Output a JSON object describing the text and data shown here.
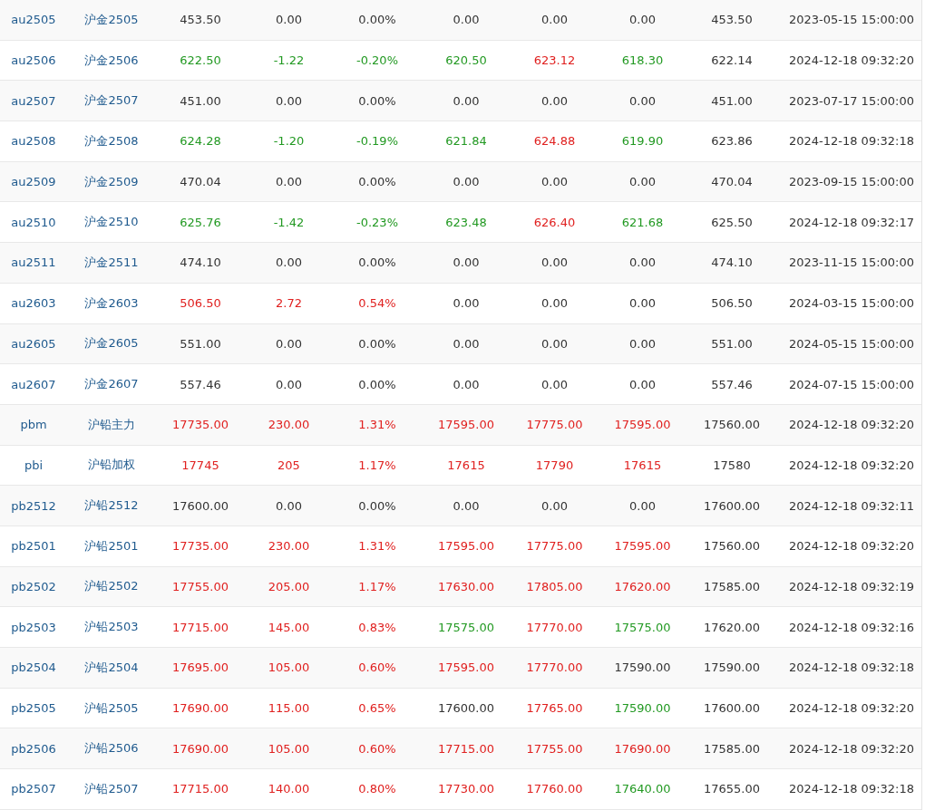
{
  "rows": [
    {
      "code": "au2505",
      "name": "沪金2505",
      "cells": [
        {
          "text": "453.50",
          "color": "#333333"
        },
        {
          "text": "0.00",
          "color": "#333333"
        },
        {
          "text": "0.00%",
          "color": "#333333"
        },
        {
          "text": "0.00",
          "color": "#333333"
        },
        {
          "text": "0.00",
          "color": "#333333"
        },
        {
          "text": "0.00",
          "color": "#333333"
        },
        {
          "text": "453.50",
          "color": "#333333"
        }
      ],
      "time": "2023-05-15 15:00:00"
    },
    {
      "code": "au2506",
      "name": "沪金2506",
      "cells": [
        {
          "text": "622.50",
          "color": "#229922"
        },
        {
          "text": "-1.22",
          "color": "#229922"
        },
        {
          "text": "-0.20%",
          "color": "#229922"
        },
        {
          "text": "620.50",
          "color": "#229922"
        },
        {
          "text": "623.12",
          "color": "#e0201f"
        },
        {
          "text": "618.30",
          "color": "#229922"
        },
        {
          "text": "622.14",
          "color": "#333333"
        }
      ],
      "time": "2024-12-18 09:32:20"
    },
    {
      "code": "au2507",
      "name": "沪金2507",
      "cells": [
        {
          "text": "451.00",
          "color": "#333333"
        },
        {
          "text": "0.00",
          "color": "#333333"
        },
        {
          "text": "0.00%",
          "color": "#333333"
        },
        {
          "text": "0.00",
          "color": "#333333"
        },
        {
          "text": "0.00",
          "color": "#333333"
        },
        {
          "text": "0.00",
          "color": "#333333"
        },
        {
          "text": "451.00",
          "color": "#333333"
        }
      ],
      "time": "2023-07-17 15:00:00"
    },
    {
      "code": "au2508",
      "name": "沪金2508",
      "cells": [
        {
          "text": "624.28",
          "color": "#229922"
        },
        {
          "text": "-1.20",
          "color": "#229922"
        },
        {
          "text": "-0.19%",
          "color": "#229922"
        },
        {
          "text": "621.84",
          "color": "#229922"
        },
        {
          "text": "624.88",
          "color": "#e0201f"
        },
        {
          "text": "619.90",
          "color": "#229922"
        },
        {
          "text": "623.86",
          "color": "#333333"
        }
      ],
      "time": "2024-12-18 09:32:18"
    },
    {
      "code": "au2509",
      "name": "沪金2509",
      "cells": [
        {
          "text": "470.04",
          "color": "#333333"
        },
        {
          "text": "0.00",
          "color": "#333333"
        },
        {
          "text": "0.00%",
          "color": "#333333"
        },
        {
          "text": "0.00",
          "color": "#333333"
        },
        {
          "text": "0.00",
          "color": "#333333"
        },
        {
          "text": "0.00",
          "color": "#333333"
        },
        {
          "text": "470.04",
          "color": "#333333"
        }
      ],
      "time": "2023-09-15 15:00:00"
    },
    {
      "code": "au2510",
      "name": "沪金2510",
      "cells": [
        {
          "text": "625.76",
          "color": "#229922"
        },
        {
          "text": "-1.42",
          "color": "#229922"
        },
        {
          "text": "-0.23%",
          "color": "#229922"
        },
        {
          "text": "623.48",
          "color": "#229922"
        },
        {
          "text": "626.40",
          "color": "#e0201f"
        },
        {
          "text": "621.68",
          "color": "#229922"
        },
        {
          "text": "625.50",
          "color": "#333333"
        }
      ],
      "time": "2024-12-18 09:32:17"
    },
    {
      "code": "au2511",
      "name": "沪金2511",
      "cells": [
        {
          "text": "474.10",
          "color": "#333333"
        },
        {
          "text": "0.00",
          "color": "#333333"
        },
        {
          "text": "0.00%",
          "color": "#333333"
        },
        {
          "text": "0.00",
          "color": "#333333"
        },
        {
          "text": "0.00",
          "color": "#333333"
        },
        {
          "text": "0.00",
          "color": "#333333"
        },
        {
          "text": "474.10",
          "color": "#333333"
        }
      ],
      "time": "2023-11-15 15:00:00"
    },
    {
      "code": "au2603",
      "name": "沪金2603",
      "cells": [
        {
          "text": "506.50",
          "color": "#e0201f"
        },
        {
          "text": "2.72",
          "color": "#e0201f"
        },
        {
          "text": "0.54%",
          "color": "#e0201f"
        },
        {
          "text": "0.00",
          "color": "#333333"
        },
        {
          "text": "0.00",
          "color": "#333333"
        },
        {
          "text": "0.00",
          "color": "#333333"
        },
        {
          "text": "506.50",
          "color": "#333333"
        }
      ],
      "time": "2024-03-15 15:00:00"
    },
    {
      "code": "au2605",
      "name": "沪金2605",
      "cells": [
        {
          "text": "551.00",
          "color": "#333333"
        },
        {
          "text": "0.00",
          "color": "#333333"
        },
        {
          "text": "0.00%",
          "color": "#333333"
        },
        {
          "text": "0.00",
          "color": "#333333"
        },
        {
          "text": "0.00",
          "color": "#333333"
        },
        {
          "text": "0.00",
          "color": "#333333"
        },
        {
          "text": "551.00",
          "color": "#333333"
        }
      ],
      "time": "2024-05-15 15:00:00"
    },
    {
      "code": "au2607",
      "name": "沪金2607",
      "cells": [
        {
          "text": "557.46",
          "color": "#333333"
        },
        {
          "text": "0.00",
          "color": "#333333"
        },
        {
          "text": "0.00%",
          "color": "#333333"
        },
        {
          "text": "0.00",
          "color": "#333333"
        },
        {
          "text": "0.00",
          "color": "#333333"
        },
        {
          "text": "0.00",
          "color": "#333333"
        },
        {
          "text": "557.46",
          "color": "#333333"
        }
      ],
      "time": "2024-07-15 15:00:00"
    },
    {
      "code": "pbm",
      "name": "沪铅主力",
      "cells": [
        {
          "text": "17735.00",
          "color": "#e0201f"
        },
        {
          "text": "230.00",
          "color": "#e0201f"
        },
        {
          "text": "1.31%",
          "color": "#e0201f"
        },
        {
          "text": "17595.00",
          "color": "#e0201f"
        },
        {
          "text": "17775.00",
          "color": "#e0201f"
        },
        {
          "text": "17595.00",
          "color": "#e0201f"
        },
        {
          "text": "17560.00",
          "color": "#333333"
        }
      ],
      "time": "2024-12-18 09:32:20"
    },
    {
      "code": "pbi",
      "name": "沪铅加权",
      "cells": [
        {
          "text": "17745",
          "color": "#e0201f"
        },
        {
          "text": "205",
          "color": "#e0201f"
        },
        {
          "text": "1.17%",
          "color": "#e0201f"
        },
        {
          "text": "17615",
          "color": "#e0201f"
        },
        {
          "text": "17790",
          "color": "#e0201f"
        },
        {
          "text": "17615",
          "color": "#e0201f"
        },
        {
          "text": "17580",
          "color": "#333333"
        }
      ],
      "time": "2024-12-18 09:32:20"
    },
    {
      "code": "pb2512",
      "name": "沪铅2512",
      "cells": [
        {
          "text": "17600.00",
          "color": "#333333"
        },
        {
          "text": "0.00",
          "color": "#333333"
        },
        {
          "text": "0.00%",
          "color": "#333333"
        },
        {
          "text": "0.00",
          "color": "#333333"
        },
        {
          "text": "0.00",
          "color": "#333333"
        },
        {
          "text": "0.00",
          "color": "#333333"
        },
        {
          "text": "17600.00",
          "color": "#333333"
        }
      ],
      "time": "2024-12-18 09:32:11"
    },
    {
      "code": "pb2501",
      "name": "沪铅2501",
      "cells": [
        {
          "text": "17735.00",
          "color": "#e0201f"
        },
        {
          "text": "230.00",
          "color": "#e0201f"
        },
        {
          "text": "1.31%",
          "color": "#e0201f"
        },
        {
          "text": "17595.00",
          "color": "#e0201f"
        },
        {
          "text": "17775.00",
          "color": "#e0201f"
        },
        {
          "text": "17595.00",
          "color": "#e0201f"
        },
        {
          "text": "17560.00",
          "color": "#333333"
        }
      ],
      "time": "2024-12-18 09:32:20"
    },
    {
      "code": "pb2502",
      "name": "沪铅2502",
      "cells": [
        {
          "text": "17755.00",
          "color": "#e0201f"
        },
        {
          "text": "205.00",
          "color": "#e0201f"
        },
        {
          "text": "1.17%",
          "color": "#e0201f"
        },
        {
          "text": "17630.00",
          "color": "#e0201f"
        },
        {
          "text": "17805.00",
          "color": "#e0201f"
        },
        {
          "text": "17620.00",
          "color": "#e0201f"
        },
        {
          "text": "17585.00",
          "color": "#333333"
        }
      ],
      "time": "2024-12-18 09:32:19"
    },
    {
      "code": "pb2503",
      "name": "沪铅2503",
      "cells": [
        {
          "text": "17715.00",
          "color": "#e0201f"
        },
        {
          "text": "145.00",
          "color": "#e0201f"
        },
        {
          "text": "0.83%",
          "color": "#e0201f"
        },
        {
          "text": "17575.00",
          "color": "#229922"
        },
        {
          "text": "17770.00",
          "color": "#e0201f"
        },
        {
          "text": "17575.00",
          "color": "#229922"
        },
        {
          "text": "17620.00",
          "color": "#333333"
        }
      ],
      "time": "2024-12-18 09:32:16"
    },
    {
      "code": "pb2504",
      "name": "沪铅2504",
      "cells": [
        {
          "text": "17695.00",
          "color": "#e0201f"
        },
        {
          "text": "105.00",
          "color": "#e0201f"
        },
        {
          "text": "0.60%",
          "color": "#e0201f"
        },
        {
          "text": "17595.00",
          "color": "#e0201f"
        },
        {
          "text": "17770.00",
          "color": "#e0201f"
        },
        {
          "text": "17590.00",
          "color": "#333333"
        },
        {
          "text": "17590.00",
          "color": "#333333"
        }
      ],
      "time": "2024-12-18 09:32:18"
    },
    {
      "code": "pb2505",
      "name": "沪铅2505",
      "cells": [
        {
          "text": "17690.00",
          "color": "#e0201f"
        },
        {
          "text": "115.00",
          "color": "#e0201f"
        },
        {
          "text": "0.65%",
          "color": "#e0201f"
        },
        {
          "text": "17600.00",
          "color": "#333333"
        },
        {
          "text": "17765.00",
          "color": "#e0201f"
        },
        {
          "text": "17590.00",
          "color": "#229922"
        },
        {
          "text": "17600.00",
          "color": "#333333"
        }
      ],
      "time": "2024-12-18 09:32:20"
    },
    {
      "code": "pb2506",
      "name": "沪铅2506",
      "cells": [
        {
          "text": "17690.00",
          "color": "#e0201f"
        },
        {
          "text": "105.00",
          "color": "#e0201f"
        },
        {
          "text": "0.60%",
          "color": "#e0201f"
        },
        {
          "text": "17715.00",
          "color": "#e0201f"
        },
        {
          "text": "17755.00",
          "color": "#e0201f"
        },
        {
          "text": "17690.00",
          "color": "#e0201f"
        },
        {
          "text": "17585.00",
          "color": "#333333"
        }
      ],
      "time": "2024-12-18 09:32:20"
    },
    {
      "code": "pb2507",
      "name": "沪铅2507",
      "cells": [
        {
          "text": "17715.00",
          "color": "#e0201f"
        },
        {
          "text": "140.00",
          "color": "#e0201f"
        },
        {
          "text": "0.80%",
          "color": "#e0201f"
        },
        {
          "text": "17730.00",
          "color": "#e0201f"
        },
        {
          "text": "17760.00",
          "color": "#e0201f"
        },
        {
          "text": "17640.00",
          "color": "#229922"
        },
        {
          "text": "17655.00",
          "color": "#333333"
        }
      ],
      "time": "2024-12-18 09:32:18"
    }
  ]
}
